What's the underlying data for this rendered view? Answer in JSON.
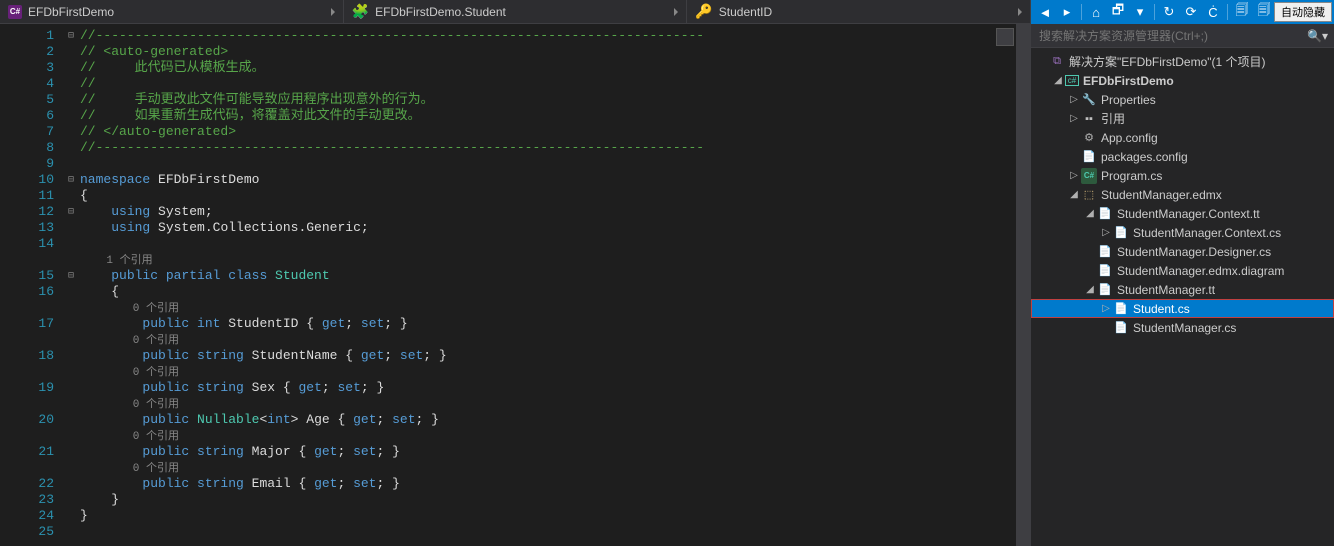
{
  "breadcrumb": {
    "project": "EFDbFirstDemo",
    "class": "EFDbFirstDemo.Student",
    "member": "StudentID"
  },
  "code": {
    "lines": [
      {
        "n": 1,
        "fold": "-",
        "segs": [
          {
            "t": "//------------------------------------------------------------------------------",
            "c": "c-comment"
          }
        ]
      },
      {
        "n": 2,
        "segs": [
          {
            "t": "// <auto-generated>",
            "c": "c-comment"
          }
        ]
      },
      {
        "n": 3,
        "segs": [
          {
            "t": "//     此代码已从模板生成。",
            "c": "c-comment"
          }
        ]
      },
      {
        "n": 4,
        "segs": [
          {
            "t": "//",
            "c": "c-comment"
          }
        ]
      },
      {
        "n": 5,
        "segs": [
          {
            "t": "//     手动更改此文件可能导致应用程序出现意外的行为。",
            "c": "c-comment"
          }
        ]
      },
      {
        "n": 6,
        "segs": [
          {
            "t": "//     如果重新生成代码，将覆盖对此文件的手动更改。",
            "c": "c-comment"
          }
        ]
      },
      {
        "n": 7,
        "segs": [
          {
            "t": "// </auto-generated>",
            "c": "c-comment"
          }
        ]
      },
      {
        "n": 8,
        "segs": [
          {
            "t": "//------------------------------------------------------------------------------",
            "c": "c-comment"
          }
        ]
      },
      {
        "n": 9,
        "segs": [
          {
            "t": "",
            "c": "c-plain"
          }
        ]
      },
      {
        "n": 10,
        "fold": "-",
        "segs": [
          {
            "t": "namespace ",
            "c": "c-keyword"
          },
          {
            "t": "EFDbFirstDemo",
            "c": "c-plain"
          }
        ]
      },
      {
        "n": 11,
        "segs": [
          {
            "t": "{",
            "c": "c-plain"
          }
        ]
      },
      {
        "n": 12,
        "fold": "-",
        "segs": [
          {
            "t": "    ",
            "c": "c-plain"
          },
          {
            "t": "using ",
            "c": "c-keyword"
          },
          {
            "t": "System;",
            "c": "c-plain"
          }
        ]
      },
      {
        "n": 13,
        "segs": [
          {
            "t": "    ",
            "c": "c-plain"
          },
          {
            "t": "using ",
            "c": "c-keyword"
          },
          {
            "t": "System.Collections.Generic;",
            "c": "c-plain"
          }
        ]
      },
      {
        "n": 14,
        "segs": [
          {
            "t": "    ",
            "c": "c-plain"
          }
        ]
      },
      {
        "n": "",
        "lens": true,
        "segs": [
          {
            "t": "    1 个引用",
            "c": "c-codelens"
          }
        ]
      },
      {
        "n": 15,
        "fold": "-",
        "segs": [
          {
            "t": "    ",
            "c": "c-plain"
          },
          {
            "t": "public partial class ",
            "c": "c-keyword"
          },
          {
            "t": "Student",
            "c": "c-type"
          }
        ]
      },
      {
        "n": 16,
        "segs": [
          {
            "t": "    {",
            "c": "c-plain"
          }
        ]
      },
      {
        "n": "",
        "lens": true,
        "segs": [
          {
            "t": "        0 个引用",
            "c": "c-codelens"
          }
        ]
      },
      {
        "n": 17,
        "segs": [
          {
            "t": "        ",
            "c": "c-plain"
          },
          {
            "t": "public int ",
            "c": "c-keyword"
          },
          {
            "t": "StudentID ",
            "c": "c-plain"
          },
          {
            "t": "{ ",
            "c": "c-plain"
          },
          {
            "t": "get",
            "c": "c-keyword"
          },
          {
            "t": "; ",
            "c": "c-plain"
          },
          {
            "t": "set",
            "c": "c-keyword"
          },
          {
            "t": "; }",
            "c": "c-plain"
          }
        ]
      },
      {
        "n": "",
        "lens": true,
        "segs": [
          {
            "t": "        0 个引用",
            "c": "c-codelens"
          }
        ]
      },
      {
        "n": 18,
        "segs": [
          {
            "t": "        ",
            "c": "c-plain"
          },
          {
            "t": "public string ",
            "c": "c-keyword"
          },
          {
            "t": "StudentName ",
            "c": "c-plain"
          },
          {
            "t": "{ ",
            "c": "c-plain"
          },
          {
            "t": "get",
            "c": "c-keyword"
          },
          {
            "t": "; ",
            "c": "c-plain"
          },
          {
            "t": "set",
            "c": "c-keyword"
          },
          {
            "t": "; }",
            "c": "c-plain"
          }
        ]
      },
      {
        "n": "",
        "lens": true,
        "segs": [
          {
            "t": "        0 个引用",
            "c": "c-codelens"
          }
        ]
      },
      {
        "n": 19,
        "segs": [
          {
            "t": "        ",
            "c": "c-plain"
          },
          {
            "t": "public string ",
            "c": "c-keyword"
          },
          {
            "t": "Sex ",
            "c": "c-plain"
          },
          {
            "t": "{ ",
            "c": "c-plain"
          },
          {
            "t": "get",
            "c": "c-keyword"
          },
          {
            "t": "; ",
            "c": "c-plain"
          },
          {
            "t": "set",
            "c": "c-keyword"
          },
          {
            "t": "; }",
            "c": "c-plain"
          }
        ]
      },
      {
        "n": "",
        "lens": true,
        "segs": [
          {
            "t": "        0 个引用",
            "c": "c-codelens"
          }
        ]
      },
      {
        "n": 20,
        "segs": [
          {
            "t": "        ",
            "c": "c-plain"
          },
          {
            "t": "public ",
            "c": "c-keyword"
          },
          {
            "t": "Nullable",
            "c": "c-type"
          },
          {
            "t": "<",
            "c": "c-plain"
          },
          {
            "t": "int",
            "c": "c-keyword"
          },
          {
            "t": "> Age ",
            "c": "c-plain"
          },
          {
            "t": "{ ",
            "c": "c-plain"
          },
          {
            "t": "get",
            "c": "c-keyword"
          },
          {
            "t": "; ",
            "c": "c-plain"
          },
          {
            "t": "set",
            "c": "c-keyword"
          },
          {
            "t": "; }",
            "c": "c-plain"
          }
        ]
      },
      {
        "n": "",
        "lens": true,
        "segs": [
          {
            "t": "        0 个引用",
            "c": "c-codelens"
          }
        ]
      },
      {
        "n": 21,
        "segs": [
          {
            "t": "        ",
            "c": "c-plain"
          },
          {
            "t": "public string ",
            "c": "c-keyword"
          },
          {
            "t": "Major ",
            "c": "c-plain"
          },
          {
            "t": "{ ",
            "c": "c-plain"
          },
          {
            "t": "get",
            "c": "c-keyword"
          },
          {
            "t": "; ",
            "c": "c-plain"
          },
          {
            "t": "set",
            "c": "c-keyword"
          },
          {
            "t": "; }",
            "c": "c-plain"
          }
        ]
      },
      {
        "n": "",
        "lens": true,
        "segs": [
          {
            "t": "        0 个引用",
            "c": "c-codelens"
          }
        ]
      },
      {
        "n": 22,
        "segs": [
          {
            "t": "        ",
            "c": "c-plain"
          },
          {
            "t": "public string ",
            "c": "c-keyword"
          },
          {
            "t": "Email ",
            "c": "c-plain"
          },
          {
            "t": "{ ",
            "c": "c-plain"
          },
          {
            "t": "get",
            "c": "c-keyword"
          },
          {
            "t": "; ",
            "c": "c-plain"
          },
          {
            "t": "set",
            "c": "c-keyword"
          },
          {
            "t": "; }",
            "c": "c-plain"
          }
        ]
      },
      {
        "n": 23,
        "segs": [
          {
            "t": "    }",
            "c": "c-plain"
          }
        ]
      },
      {
        "n": 24,
        "segs": [
          {
            "t": "}",
            "c": "c-plain"
          }
        ]
      },
      {
        "n": 25,
        "segs": [
          {
            "t": "",
            "c": "c-plain"
          }
        ]
      }
    ]
  },
  "sidebar": {
    "search_placeholder": "搜索解决方案资源管理器(Ctrl+;)",
    "autohide": "自动隐藏",
    "tree": [
      {
        "depth": 0,
        "arrow": "",
        "icon": "ic-sol",
        "iconText": "⧉",
        "label": "解决方案\"EFDbFirstDemo\"(1 个项目)"
      },
      {
        "depth": 1,
        "arrow": "▲",
        "icon": "ic-proj",
        "iconText": "c#",
        "label": "EFDbFirstDemo",
        "bold": true
      },
      {
        "depth": 2,
        "arrow": "▷",
        "icon": "ic-folder",
        "iconText": "🔧",
        "label": "Properties"
      },
      {
        "depth": 2,
        "arrow": "▷",
        "icon": "ic-ref",
        "iconText": "▪▪",
        "label": "引用"
      },
      {
        "depth": 2,
        "arrow": "",
        "icon": "ic-config",
        "iconText": "⚙",
        "label": "App.config"
      },
      {
        "depth": 2,
        "arrow": "",
        "icon": "ic-config",
        "iconText": "📄",
        "label": "packages.config"
      },
      {
        "depth": 2,
        "arrow": "▷",
        "icon": "ic-cs",
        "iconText": "C#",
        "label": "Program.cs"
      },
      {
        "depth": 2,
        "arrow": "▲",
        "icon": "ic-edmx",
        "iconText": "⬚",
        "label": "StudentManager.edmx"
      },
      {
        "depth": 3,
        "arrow": "▲",
        "icon": "ic-tt",
        "iconText": "📄",
        "label": "StudentManager.Context.tt"
      },
      {
        "depth": 4,
        "arrow": "▷",
        "icon": "ic-file",
        "iconText": "📄",
        "label": "StudentManager.Context.cs"
      },
      {
        "depth": 3,
        "arrow": "",
        "icon": "ic-file",
        "iconText": "📄",
        "label": "StudentManager.Designer.cs"
      },
      {
        "depth": 3,
        "arrow": "",
        "icon": "ic-file",
        "iconText": "📄",
        "label": "StudentManager.edmx.diagram"
      },
      {
        "depth": 3,
        "arrow": "▲",
        "icon": "ic-tt",
        "iconText": "📄",
        "label": "StudentManager.tt"
      },
      {
        "depth": 4,
        "arrow": "▷",
        "icon": "ic-file",
        "iconText": "📄",
        "label": "Student.cs",
        "selected": true
      },
      {
        "depth": 4,
        "arrow": "",
        "icon": "ic-file",
        "iconText": "📄",
        "label": "StudentManager.cs"
      }
    ]
  }
}
